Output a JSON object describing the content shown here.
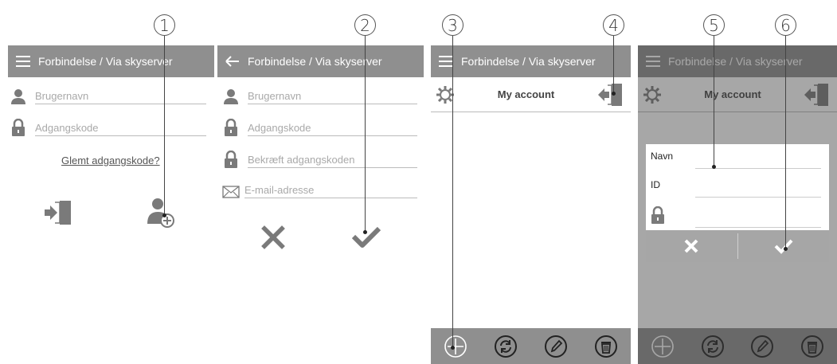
{
  "callouts": [
    "1",
    "2",
    "3",
    "4",
    "5",
    "6"
  ],
  "screen1": {
    "title": "Forbindelse / Via skyserver",
    "username_placeholder": "Brugernavn",
    "password_placeholder": "Adgangskode",
    "forgot_link": "Glemt adgangskode?",
    "icons": [
      "menu-icon",
      "user-icon",
      "lock-icon",
      "login-door-icon",
      "add-user-icon"
    ]
  },
  "screen2": {
    "title": "Forbindelse / Via skyserver",
    "username_placeholder": "Brugernavn",
    "password_placeholder": "Adgangskode",
    "confirm_placeholder": "Bekræft adgangskoden",
    "email_placeholder": "E-mail-adresse",
    "icons": [
      "back-arrow-icon",
      "user-icon",
      "lock-icon",
      "envelope-icon",
      "cancel-x-icon",
      "confirm-check-icon"
    ]
  },
  "screen3": {
    "title": "Forbindelse / Via skyserver",
    "account_title": "My account",
    "icons": [
      "menu-icon",
      "gear-icon",
      "logout-door-icon",
      "add-circle-icon",
      "refresh-icon",
      "edit-pencil-icon",
      "trash-icon"
    ]
  },
  "screen4": {
    "title": "Forbindelse / Via skyserver",
    "account_title": "My account",
    "name_label": "Navn",
    "id_label": "ID",
    "icons": [
      "menu-icon",
      "gear-icon",
      "logout-door-icon",
      "lock-icon",
      "cancel-x-icon",
      "confirm-check-icon",
      "add-circle-icon",
      "refresh-icon",
      "edit-pencil-icon",
      "trash-icon"
    ]
  },
  "colors": {
    "appbar": "#8f8f8f",
    "icon_gray": "#7a7a7a",
    "overlay": "#6b6b6b"
  }
}
